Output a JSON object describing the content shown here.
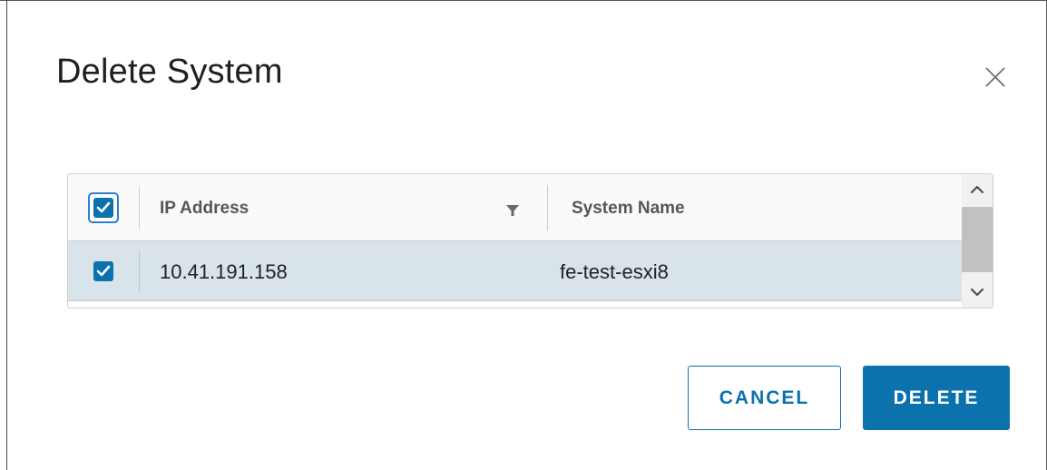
{
  "dialog": {
    "title": "Delete System",
    "close_icon": "close-icon"
  },
  "table": {
    "columns": [
      {
        "label": "IP Address",
        "filter_icon": "filter-icon"
      },
      {
        "label": "System Name"
      }
    ],
    "select_all_checked": true,
    "rows": [
      {
        "ip": "10.41.191.158",
        "name": "fe-test-esxi8",
        "selected": true
      }
    ]
  },
  "buttons": {
    "cancel": "CANCEL",
    "delete": "DELETE"
  },
  "colors": {
    "accent": "#0b72ad",
    "selected_row": "#d8e3ea"
  }
}
